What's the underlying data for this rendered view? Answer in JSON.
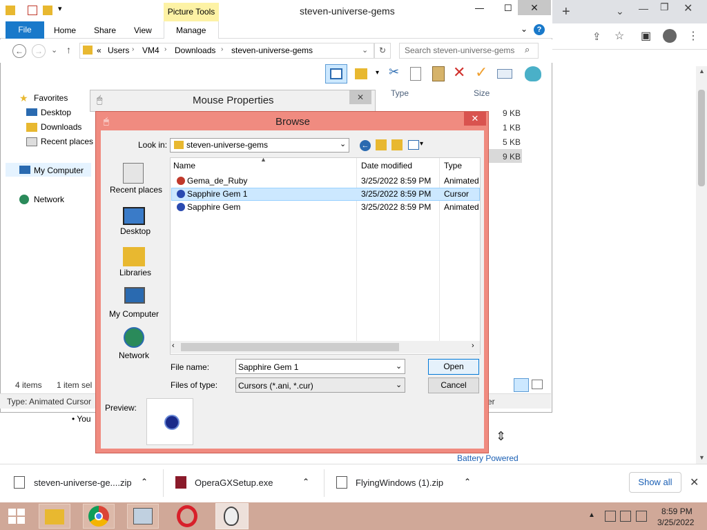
{
  "explorer": {
    "title": "steven-universe-gems",
    "picture_tools": "Picture Tools",
    "tabs": [
      "File",
      "Home",
      "Share",
      "View",
      "Manage"
    ],
    "breadcrumb": [
      "«",
      "Users",
      "VM4",
      "Downloads",
      "steven-universe-gems"
    ],
    "search_placeholder": "Search steven-universe-gems",
    "nav": {
      "favorites": "Favorites",
      "desktop": "Desktop",
      "downloads": "Downloads",
      "recent": "Recent places",
      "computer": "My Computer",
      "network": "Network"
    },
    "columns": {
      "type": "Type",
      "size": "Size"
    },
    "sizes": [
      "9 KB",
      "1 KB",
      "5 KB",
      "9 KB"
    ],
    "status_items": "4 items",
    "status_selected": "1 item sel",
    "detail_type": "Type: Animated Cursor",
    "detail_right": "er"
  },
  "mouse_properties": {
    "title": "Mouse Properties"
  },
  "browse": {
    "title": "Browse",
    "look_in_label": "Look in:",
    "look_in_value": "steven-universe-gems",
    "places": [
      "Recent places",
      "Desktop",
      "Libraries",
      "My Computer",
      "Network"
    ],
    "columns": {
      "name": "Name",
      "date": "Date modified",
      "type": "Type"
    },
    "files": [
      {
        "name": "Gema_de_Ruby",
        "date": "3/25/2022 8:59 PM",
        "type": "Animated"
      },
      {
        "name": "Sapphire Gem 1",
        "date": "3/25/2022 8:59 PM",
        "type": "Cursor"
      },
      {
        "name": "Sapphire Gem",
        "date": "3/25/2022 8:59 PM",
        "type": "Animated"
      }
    ],
    "file_name_label": "File name:",
    "file_name_value": "Sapphire Gem 1",
    "file_type_label": "Files of type:",
    "file_type_value": "Cursors (*.ani, *.cur)",
    "open": "Open",
    "cancel": "Cancel",
    "preview_label": "Preview:"
  },
  "browser": {
    "page_bullet": "You",
    "battery_text": "Battery Powered"
  },
  "downloads": [
    {
      "name": "steven-universe-ge....zip"
    },
    {
      "name": "OperaGXSetup.exe"
    },
    {
      "name": "FlyingWindows (1).zip"
    }
  ],
  "downloads_show_all": "Show all",
  "taskbar": {
    "time": "8:59 PM",
    "date": "3/25/2022"
  },
  "colors": {
    "dialog_border": "#f08b80",
    "taskbar": "#d0a898",
    "accent": "#1979ca"
  }
}
